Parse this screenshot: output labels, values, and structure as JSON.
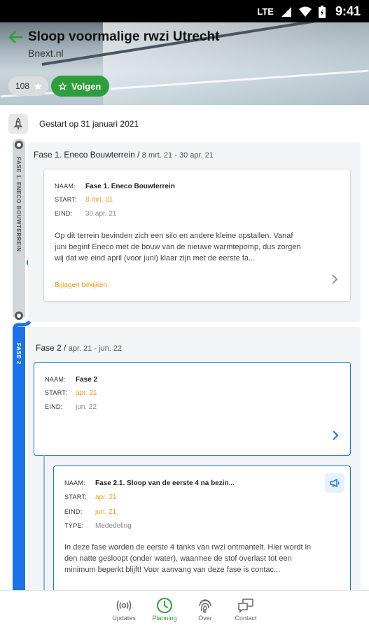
{
  "status_bar": {
    "network": "LTE",
    "time": "9:41"
  },
  "header": {
    "title": "Sloop voormalige rwzi Utrecht",
    "subtitle": "Bnext.nl",
    "follower_count": "108",
    "follow_label": "Volgen"
  },
  "timeline": {
    "start_text": "Gestart op 31 januari 2021",
    "phase1_vertical": "FASE 1. ENECO BOUWTERREIN",
    "phase2_vertical": "FASE 2"
  },
  "phase1": {
    "heading": "Fase 1. Eneco Bouwterrein",
    "sep": " / ",
    "dates": "8 mrt. 21 - 30 apr. 21",
    "card": {
      "name_key": "NAAM:",
      "name": "Fase 1. Eneco Bouwterrein",
      "start_key": "START:",
      "start": "8 mrt. 21",
      "end_key": "EIND:",
      "end": "30 apr. 21",
      "description": "Op dit terrein bevinden zich een silo en andere kleine opstallen. Vanaf juni begint Eneco met de bouw van de nieuwe warmtepomp, dus zorgen wij dat we eind april (voor juni) klaar zijn met de eerste fa...",
      "attachments_link": "Bijlagen bekijken"
    }
  },
  "phase2": {
    "heading": "Fase 2",
    "sep": " / ",
    "dates": "apr. 21 - jun. 22",
    "card": {
      "name_key": "NAAM:",
      "name": "Fase 2",
      "start_key": "START:",
      "start": "apr. 21",
      "end_key": "EIND:",
      "end": "jun. 22"
    },
    "subcard": {
      "name_key": "NAAM:",
      "name": "Fase 2.1. Sloop van de eerste 4 na bezin...",
      "start_key": "START:",
      "start": "apr. 21",
      "end_key": "EIND:",
      "end": "jun. 21",
      "type_key": "TYPE:",
      "type": "Mededeling",
      "description": "In deze fase worden de eerste 4 tanks van rwzi ontmantelt. Hier wordt in den natte gesloopt (onder water), waarmee de stof overlast tot een minimum beperkt blijft! Voor aanvang van deze fase is contac..."
    }
  },
  "bottom_nav": {
    "items": [
      {
        "label": "Updates",
        "icon": "broadcast-icon"
      },
      {
        "label": "Planning",
        "icon": "clock-icon"
      },
      {
        "label": "Over",
        "icon": "fingerprint-icon"
      },
      {
        "label": "Contact",
        "icon": "chat-icon"
      }
    ],
    "active": "Planning"
  },
  "colors": {
    "brand_green": "#2e9e3c",
    "timeline_blue": "#1a73e8",
    "accent_orange": "#f39c12"
  }
}
